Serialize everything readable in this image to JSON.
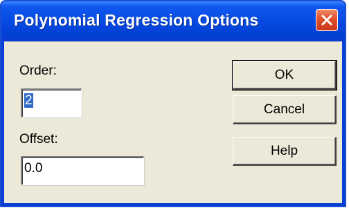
{
  "dialog": {
    "title": "Polynomial Regression Options",
    "close_icon": "close-icon"
  },
  "order": {
    "label": "Order:",
    "value": "2"
  },
  "offset": {
    "label": "Offset:",
    "value": "0.0"
  },
  "buttons": {
    "ok": "OK",
    "cancel": "Cancel",
    "help": "Help"
  },
  "colors": {
    "titlebar": "#0648e0",
    "close_button": "#e2512a",
    "dialog_background": "#ece9d8",
    "selection": "#316ac5"
  }
}
